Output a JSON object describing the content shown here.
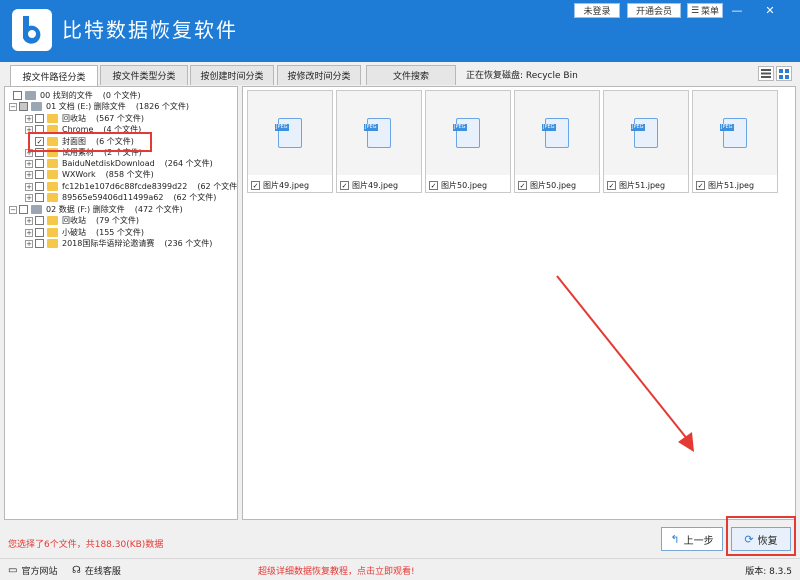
{
  "app": {
    "title": "比特数据恢复软件",
    "login_label": "未登录",
    "vip_label": "开通会员",
    "menu_label": "菜单",
    "minimize_glyph": "—",
    "close_glyph": "✕"
  },
  "tabs": [
    {
      "label": "按文件路径分类"
    },
    {
      "label": "按文件类型分类"
    },
    {
      "label": "按创建时间分类"
    },
    {
      "label": "按修改时间分类"
    },
    {
      "label": "文件搜索"
    }
  ],
  "restoring_disk": "正在恢复磁盘: Recycle Bin",
  "tree": [
    {
      "name": "00 找到的文件",
      "count": "(0 个文件)"
    },
    {
      "name": "01 文档 (E:) 删除文件",
      "count": "(1826 个文件)"
    },
    {
      "name": "回收站",
      "count": "(567 个文件)"
    },
    {
      "name": "Chrome",
      "count": "(4 个文件)"
    },
    {
      "name": "封面图",
      "count": "(6 个文件)",
      "check": "✓"
    },
    {
      "name": "试用素材",
      "count": "(2 个文件)"
    },
    {
      "name": "BaiduNetdiskDownload",
      "count": "(264 个文件)"
    },
    {
      "name": "WXWork",
      "count": "(858 个文件)"
    },
    {
      "name": "fc12b1e107d6c88fcde8399d22",
      "count": "(62 个文件)"
    },
    {
      "name": "89565e59406d11499a62",
      "count": "(62 个文件)"
    },
    {
      "name": "02 数据 (F:) 删除文件",
      "count": "(472 个文件)"
    },
    {
      "name": "回收站",
      "count": "(79 个文件)"
    },
    {
      "name": "小破站",
      "count": "(155 个文件)"
    },
    {
      "name": "2018国际华语辩论邀请赛",
      "count": "(236 个文件)"
    }
  ],
  "tree_expanders": {
    "plus": "+",
    "minus": "−"
  },
  "files": [
    {
      "name": "图片49.jpeg",
      "check": "✓",
      "type_tag": "JPEG"
    },
    {
      "name": "图片49.jpeg",
      "check": "✓",
      "type_tag": "JPEG"
    },
    {
      "name": "图片50.jpeg",
      "check": "✓",
      "type_tag": "JPEG"
    },
    {
      "name": "图片50.jpeg",
      "check": "✓",
      "type_tag": "JPEG"
    },
    {
      "name": "图片51.jpeg",
      "check": "✓",
      "type_tag": "JPEG"
    },
    {
      "name": "图片51.jpeg",
      "check": "✓",
      "type_tag": "JPEG"
    }
  ],
  "status": "您选择了6个文件，共188.30(KB)数据",
  "buttons": {
    "prev_label": "上一步",
    "prev_glyph": "↰",
    "recover_label": "恢复",
    "recover_glyph": "⟳"
  },
  "footer": {
    "website_label": "官方网站",
    "website_glyph": "▭",
    "support_label": "在线客服",
    "support_glyph": "☊",
    "promo": "超级详细数据恢复教程，点击立即观看!",
    "version": "版本: 8.3.5"
  },
  "colors": {
    "titlebar": "#1e7bd6",
    "annotation_red": "#e53935",
    "folder_yellow": "#f5c84c"
  }
}
